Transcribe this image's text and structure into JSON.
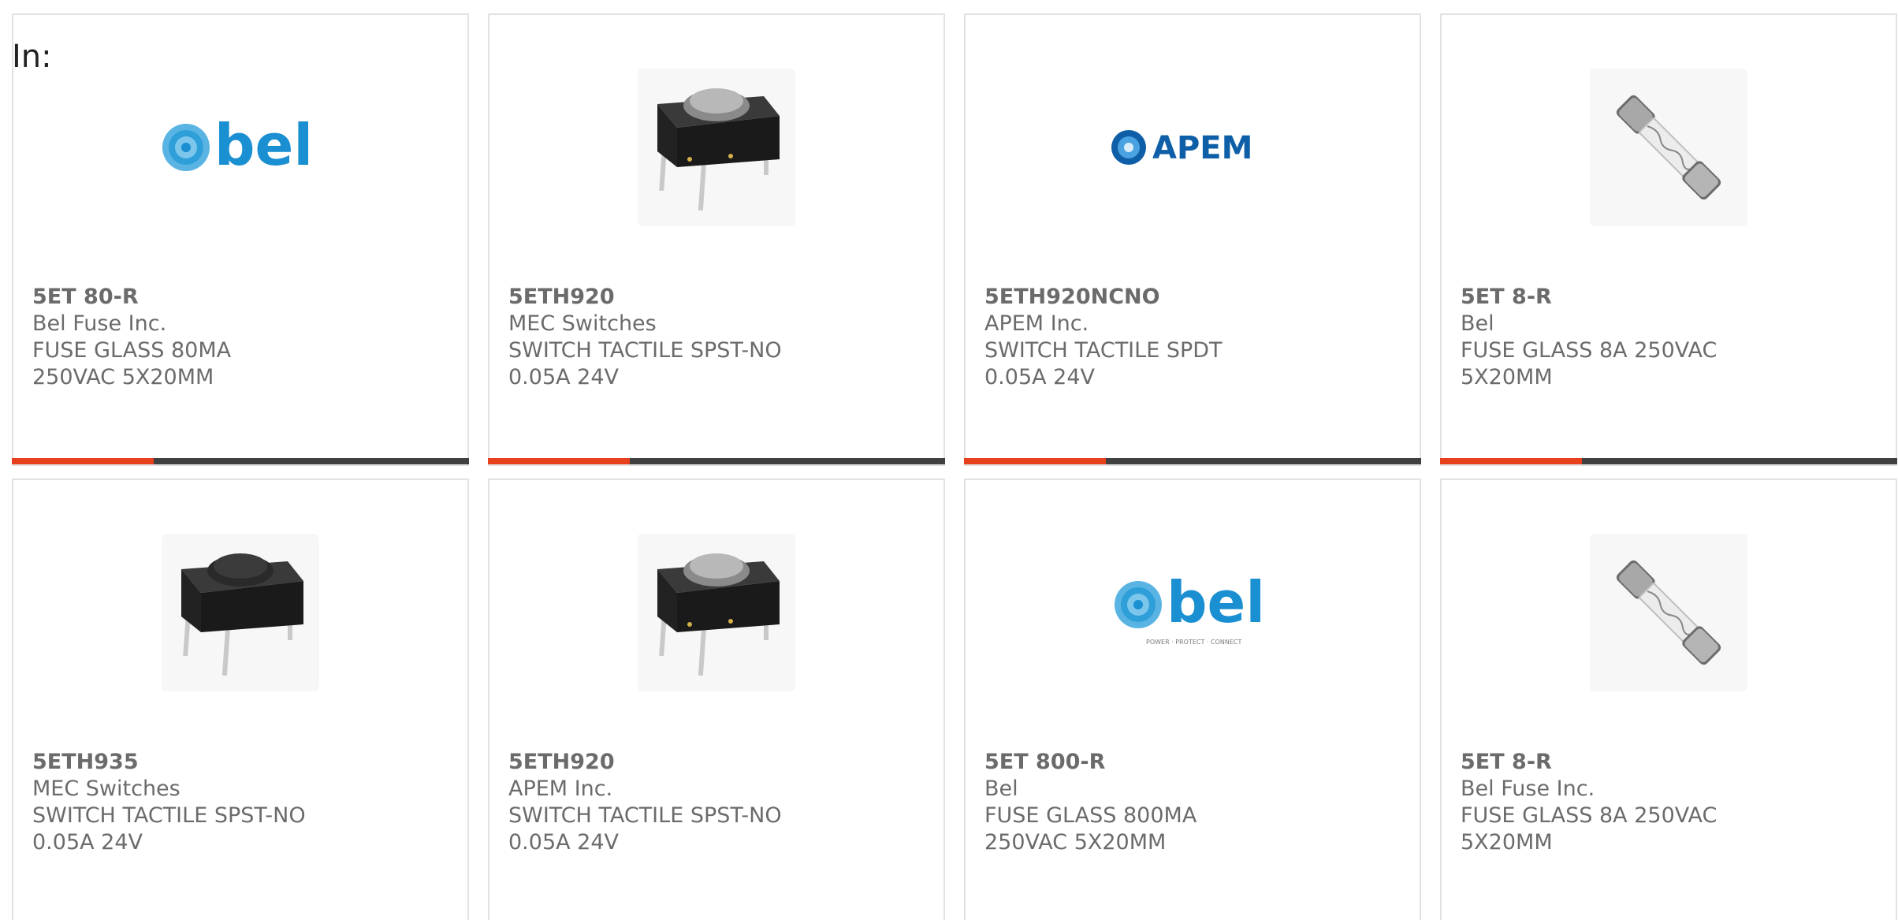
{
  "search": {
    "label": "In:"
  },
  "cards": [
    {
      "part": "5ET 80-R",
      "mfr": "Bel Fuse Inc.",
      "desc": "FUSE GLASS 80MA 250VAC 5X20MM",
      "image": "bel-logo",
      "bar_progress": 0.31
    },
    {
      "part": "5ETH920",
      "mfr": "MEC Switches",
      "desc": "SWITCH TACTILE SPST-NO 0.05A 24V",
      "image": "tactile-switch-gray",
      "bar_progress": 0.31
    },
    {
      "part": "5ETH920NCNO",
      "mfr": "APEM Inc.",
      "desc": "SWITCH TACTILE SPDT 0.05A 24V",
      "image": "apem-logo",
      "bar_progress": 0.31
    },
    {
      "part": "5ET 8-R",
      "mfr": "Bel",
      "desc": "FUSE GLASS 8A 250VAC 5X20MM",
      "image": "glass-fuse",
      "bar_progress": 0.31
    },
    {
      "part": "5ETH935",
      "mfr": "MEC Switches",
      "desc": "SWITCH TACTILE SPST-NO 0.05A 24V",
      "image": "tactile-switch-black"
    },
    {
      "part": "5ETH920",
      "mfr": "APEM Inc.",
      "desc": "SWITCH TACTILE SPST-NO 0.05A 24V",
      "image": "tactile-switch-gray"
    },
    {
      "part": "5ET 800-R",
      "mfr": "Bel",
      "desc": "FUSE GLASS 800MA 250VAC 5X20MM",
      "image": "bel-logo-tagline"
    },
    {
      "part": "5ET 8-R",
      "mfr": "Bel Fuse Inc.",
      "desc": "FUSE GLASS 8A 250VAC 5X20MM",
      "image": "glass-fuse"
    }
  ],
  "logos": {
    "bel_text": "bel",
    "bel_tagline": "POWER · PROTECT · CONNECT",
    "apem_text": "APEM"
  },
  "colors": {
    "accent": "#e8401c",
    "bar": "#404040",
    "text": "#6b6b6b",
    "bel_blue": "#1a8fd1",
    "apem_blue": "#0e5fa8"
  }
}
